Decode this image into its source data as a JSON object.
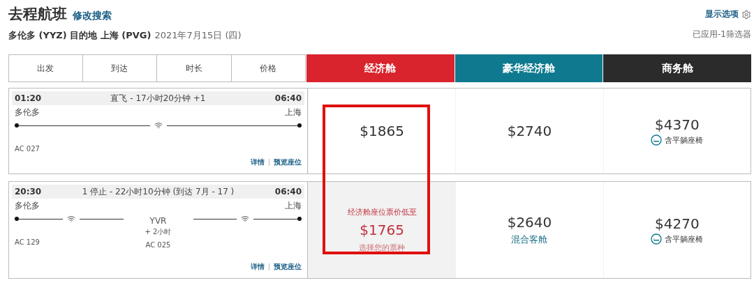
{
  "title": "去程航班",
  "modify_link": "修改搜索",
  "route": {
    "text": "多伦多 (YYZ) 目的地 上海 (PVG)",
    "date": "2021年7月15日 (四)"
  },
  "display_options": "显示选项",
  "filters_applied": "已应用-1筛选器",
  "sort_columns": [
    "出发",
    "到达",
    "时长",
    "价格"
  ],
  "cabins": [
    {
      "label": "经济舱",
      "color": "#d9232d"
    },
    {
      "label": "豪华经济舱",
      "color": "#0f7a8f"
    },
    {
      "label": "商务舱",
      "color": "#2b2b2b"
    }
  ],
  "highlight_frame": true,
  "flights": [
    {
      "depart": "01:20",
      "summary": "直飞 - 17小时20分钟 +1",
      "arrive": "06:40",
      "origin": "多伦多",
      "destination": "上海",
      "legs": [
        {
          "flight": "AC 027",
          "wifi": true
        }
      ],
      "links": [
        "详情",
        "预览座位"
      ],
      "fares": [
        {
          "kind": "price",
          "price": "$1865",
          "selected": false
        },
        {
          "kind": "price",
          "price": "$2740",
          "selected": false
        },
        {
          "kind": "price",
          "price": "$4370",
          "note": "含平躺座椅",
          "selected": false
        }
      ]
    },
    {
      "depart": "20:30",
      "summary": "1 停止 - 22小时10分钟 (到达 7月 - 17 )",
      "arrive": "06:40",
      "origin": "多伦多",
      "destination": "上海",
      "legs": [
        {
          "flight": "AC 129",
          "wifi": true
        },
        {
          "wifi": true
        }
      ],
      "stops": [
        {
          "code": "YVR",
          "layover": "+ 2小时",
          "flight": "AC 025"
        }
      ],
      "links": [
        "详情",
        "预览座位"
      ],
      "fares": [
        {
          "kind": "lowest",
          "label": "经济舱座位票价低至",
          "price": "$1765",
          "sub": "选择您的票种",
          "selected": true
        },
        {
          "kind": "price",
          "price": "$2640",
          "sub": "混合客舱",
          "selected": false
        },
        {
          "kind": "price",
          "price": "$4270",
          "note": "含平躺座椅",
          "selected": false
        }
      ]
    }
  ]
}
